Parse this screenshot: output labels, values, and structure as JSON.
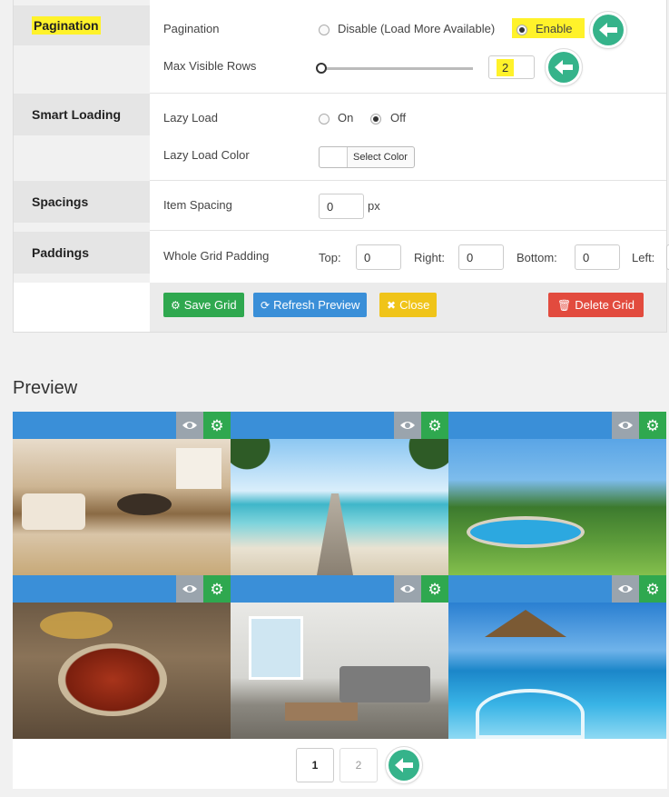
{
  "settings": {
    "pagination": {
      "section": "Pagination",
      "field": "Pagination",
      "option_disable": "Disable (Load More Available)",
      "option_enable": "Enable",
      "selected": "Enable",
      "max_rows_label": "Max Visible Rows",
      "max_rows_value": "2"
    },
    "smart_loading": {
      "section": "Smart Loading",
      "lazy_label": "Lazy Load",
      "on": "On",
      "off": "Off",
      "selected": "Off",
      "color_label": "Lazy Load Color",
      "color_button": "Select Color"
    },
    "spacings": {
      "section": "Spacings",
      "item_label": "Item Spacing",
      "item_value": "0",
      "unit": "px"
    },
    "paddings": {
      "section": "Paddings",
      "whole_label": "Whole Grid Padding",
      "top_label": "Top:",
      "top_value": "0",
      "right_label": "Right:",
      "right_value": "0",
      "bottom_label": "Bottom:",
      "bottom_value": "0",
      "left_label": "Left:"
    }
  },
  "toolbar": {
    "save": "Save Grid",
    "refresh": "Refresh Preview",
    "close": "Close",
    "delete": "Delete Grid"
  },
  "preview": {
    "title": "Preview",
    "pages": [
      "1",
      "2"
    ],
    "current_page": "1"
  },
  "colors": {
    "accent_green": "#35b38a",
    "save": "#2fa84f",
    "refresh": "#3a8fd8",
    "close": "#f0c419",
    "delete": "#e24b3e",
    "highlight": "#fff22a"
  }
}
